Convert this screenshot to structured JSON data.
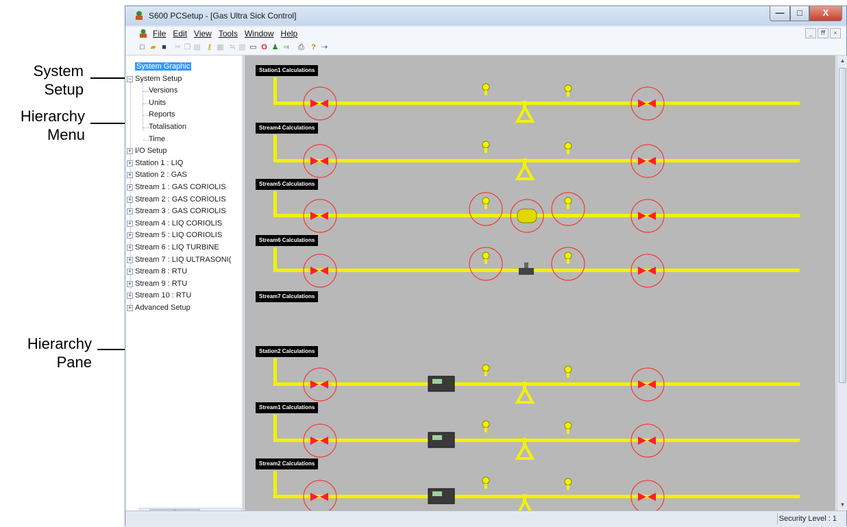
{
  "callouts": {
    "system_setup": "System\nSetup",
    "hierarchy_menu": "Hierarchy\nMenu",
    "hierarchy_pane": "Hierarchy\nPane"
  },
  "window": {
    "title": "S600 PCSetup  - [Gas Ultra Sick Control]",
    "min_glyph": "—",
    "max_glyph": "□",
    "close_glyph": "X"
  },
  "menu": {
    "items": [
      "File",
      "Edit",
      "View",
      "Tools",
      "Window",
      "Help"
    ],
    "mdi_controls": [
      "_",
      "ﬀ",
      "×"
    ]
  },
  "toolbar": {
    "icons": [
      "new-file-icon",
      "open-folder-icon",
      "save-icon",
      "cut-icon",
      "copy-icon",
      "paste-icon",
      "key-icon",
      "disabled-icon",
      "disabled-icon",
      "disabled-icon",
      "rectangle-icon",
      "red-circle-icon",
      "green-user-icon",
      "plug-icon",
      "print-icon",
      "help-icon",
      "arrow-icon"
    ]
  },
  "tree": {
    "items": [
      {
        "label": "System Graphic",
        "level": 0,
        "expander": "",
        "selected": true
      },
      {
        "label": "System Setup",
        "level": 0,
        "expander": "-"
      },
      {
        "label": "Versions",
        "level": 1,
        "expander": ""
      },
      {
        "label": "Units",
        "level": 1,
        "expander": ""
      },
      {
        "label": "Reports",
        "level": 1,
        "expander": ""
      },
      {
        "label": "Totalisation",
        "level": 1,
        "expander": ""
      },
      {
        "label": "Time",
        "level": 1,
        "expander": ""
      },
      {
        "label": "I/O Setup",
        "level": 0,
        "expander": "+"
      },
      {
        "label": "Station 1 : LIQ",
        "level": 0,
        "expander": "+"
      },
      {
        "label": "Station 2 : GAS",
        "level": 0,
        "expander": "+"
      },
      {
        "label": "Stream 1 : GAS CORIOLIS",
        "level": 0,
        "expander": "+"
      },
      {
        "label": "Stream 2 : GAS CORIOLIS",
        "level": 0,
        "expander": "+"
      },
      {
        "label": "Stream 3 : GAS CORIOLIS",
        "level": 0,
        "expander": "+"
      },
      {
        "label": "Stream 4 : LIQ CORIOLIS",
        "level": 0,
        "expander": "+"
      },
      {
        "label": "Stream 5 : LIQ CORIOLIS",
        "level": 0,
        "expander": "+"
      },
      {
        "label": "Stream 6 : LIQ TURBINE",
        "level": 0,
        "expander": "+"
      },
      {
        "label": "Stream 7 : LIQ ULTRASONI(",
        "level": 0,
        "expander": "+"
      },
      {
        "label": "Stream 8 : RTU",
        "level": 0,
        "expander": "+"
      },
      {
        "label": "Stream 9 : RTU",
        "level": 0,
        "expander": "+"
      },
      {
        "label": "Stream 10 : RTU",
        "level": 0,
        "expander": "+"
      },
      {
        "label": "Advanced Setup",
        "level": 0,
        "expander": "+"
      }
    ]
  },
  "graphic": {
    "pipe_color": "#f2f200",
    "valve_color": "#ff2020",
    "background": "#b8b8b8",
    "sections": [
      {
        "label": "Station1 Calculations",
        "meter": "meter-a"
      },
      {
        "label": "Stream4 Calculations",
        "meter": "meter-a"
      },
      {
        "label": "Stream5 Calculations",
        "meter": "coriolis"
      },
      {
        "label": "Stream6 Calculations",
        "meter": "turbine"
      },
      {
        "label": "Stream7 Calculations",
        "meter": "none"
      },
      {
        "label": "Station2 Calculations",
        "meter": "ultrasonic"
      },
      {
        "label": "Stream1 Calculations",
        "meter": "ultrasonic"
      },
      {
        "label": "Stream2 Calculations",
        "meter": "ultrasonic"
      }
    ]
  },
  "status": {
    "security": "Security Level : 1"
  }
}
